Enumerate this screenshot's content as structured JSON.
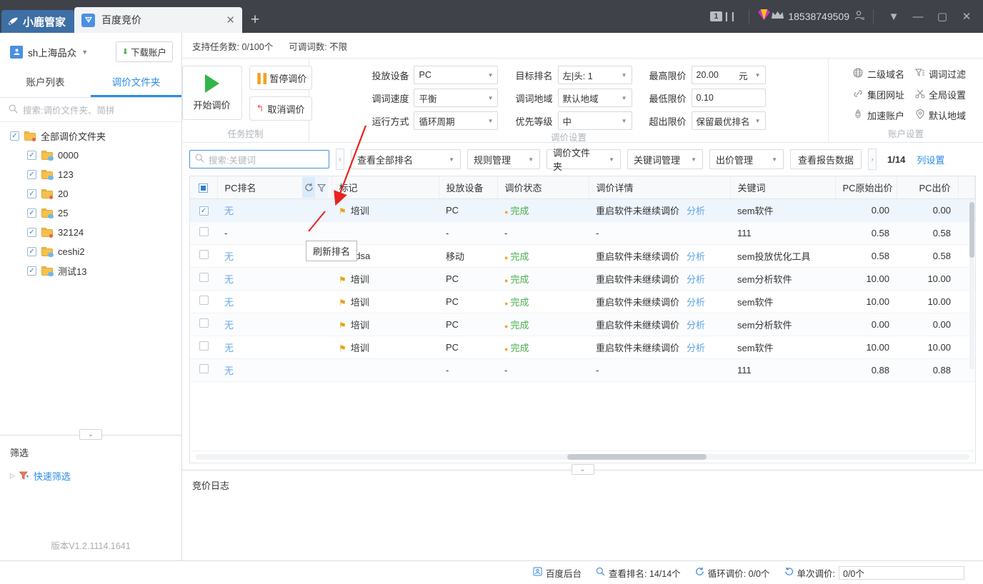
{
  "titlebar": {
    "app_name": "小鹿管家",
    "tab_label": "百度竞价",
    "tab_close": "✕",
    "new_tab": "+",
    "message_count": "1",
    "phone": "18538749509",
    "minimize": "—",
    "maximize": "▢",
    "close": "✕",
    "dropdown": "▼"
  },
  "sidebar": {
    "account_name": "sh上海品众",
    "download_button": "下载账户",
    "tabs": [
      {
        "label": "账户列表",
        "selected": false
      },
      {
        "label": "调价文件夹",
        "selected": true
      }
    ],
    "search_placeholder": "搜索:调价文件夹、简拼",
    "tree_root": {
      "label": "全部调价文件夹",
      "checked": true,
      "badge": "dot"
    },
    "tree_items": [
      {
        "label": "0000",
        "checked": true,
        "badge": "cloud"
      },
      {
        "label": "123",
        "checked": true,
        "badge": "cloud"
      },
      {
        "label": "20",
        "checked": true,
        "badge": "dot"
      },
      {
        "label": "25",
        "checked": true,
        "badge": "cloud"
      },
      {
        "label": "32124",
        "checked": true,
        "badge": "dot"
      },
      {
        "label": "ceshi2",
        "checked": true,
        "badge": "cloud"
      },
      {
        "label": "测试13",
        "checked": true,
        "badge": "cloud"
      }
    ],
    "filter_title": "筛选",
    "quick_filter": "快速筛选",
    "version": "版本V1.2.1114.1641"
  },
  "main": {
    "quota": {
      "tasks": "支持任务数: 0/100个",
      "words": "可调词数: 不限"
    },
    "task_panel": {
      "label": "任务控制",
      "start": "开始调价",
      "pause": "暂停调价",
      "cancel": "取消调价"
    },
    "tune_panel": {
      "label": "调价设置",
      "fields": [
        {
          "label": "投放设备",
          "value": "PC"
        },
        {
          "label": "调词速度",
          "value": "平衡"
        },
        {
          "label": "运行方式",
          "value": "循环周期"
        },
        {
          "label": "目标排名",
          "value": "左|头: 1"
        },
        {
          "label": "调词地域",
          "value": "默认地域"
        },
        {
          "label": "优先等级",
          "value": "中"
        },
        {
          "label": "最高限价",
          "value": "20.00",
          "unit": "元"
        },
        {
          "label": "最低限价",
          "value": "0.10"
        },
        {
          "label": "超出限价",
          "value": "保留最优排名"
        }
      ]
    },
    "account_panel": {
      "label": "账户设置",
      "items": [
        {
          "label": "二级域名",
          "icon": "globe-icon"
        },
        {
          "label": "调词过滤",
          "icon": "funnel-icon"
        },
        {
          "label": "集团网址",
          "icon": "link-icon"
        },
        {
          "label": "全局设置",
          "icon": "scissors-icon"
        },
        {
          "label": "加速账户",
          "icon": "rocket-icon"
        },
        {
          "label": "默认地域",
          "icon": "pin-icon"
        }
      ]
    },
    "toolbar": {
      "search_placeholder": "搜索:关键词",
      "collapse_left": "‹",
      "collapse_right": "›",
      "buttons": [
        "查看全部排名",
        "规则管理",
        "调价文件夹",
        "关键词管理",
        "出价管理"
      ],
      "report_button": "查看报告数据",
      "pager": "1/14",
      "column_settings": "列设置"
    },
    "tooltip": "刷新排名",
    "table": {
      "columns": [
        "PC排名",
        "标记",
        "投放设备",
        "调价状态",
        "调价详情",
        "关键词",
        "PC原始出价",
        "PC出价"
      ],
      "analyze_link": "分析",
      "rows": [
        {
          "checked": true,
          "rank": "无",
          "mark": "培训",
          "device": "PC",
          "status": "完成",
          "detail": "重启软件未继续调价",
          "keyword": "sem软件",
          "orig": "0.00",
          "bid": "0.00"
        },
        {
          "checked": false,
          "rank": "-",
          "mark": "",
          "device": "-",
          "status": "-",
          "detail": "-",
          "keyword": "111",
          "orig": "0.58",
          "bid": "0.58"
        },
        {
          "checked": false,
          "rank": "无",
          "mark": "sdsa",
          "device": "移动",
          "status": "完成",
          "detail": "重启软件未继续调价",
          "keyword": "sem投放优化工具",
          "orig": "0.58",
          "bid": "0.58"
        },
        {
          "checked": false,
          "rank": "无",
          "mark": "培训",
          "device": "PC",
          "status": "完成",
          "detail": "重启软件未继续调价",
          "keyword": "sem分析软件",
          "orig": "10.00",
          "bid": "10.00"
        },
        {
          "checked": false,
          "rank": "无",
          "mark": "培训",
          "device": "PC",
          "status": "完成",
          "detail": "重启软件未继续调价",
          "keyword": "sem软件",
          "orig": "10.00",
          "bid": "10.00"
        },
        {
          "checked": false,
          "rank": "无",
          "mark": "培训",
          "device": "PC",
          "status": "完成",
          "detail": "重启软件未继续调价",
          "keyword": "sem分析软件",
          "orig": "0.00",
          "bid": "0.00"
        },
        {
          "checked": false,
          "rank": "无",
          "mark": "培训",
          "device": "PC",
          "status": "完成",
          "detail": "重启软件未继续调价",
          "keyword": "sem软件",
          "orig": "10.00",
          "bid": "10.00"
        },
        {
          "checked": false,
          "rank": "无",
          "mark": "",
          "device": "-",
          "status": "-",
          "detail": "-",
          "keyword": "111",
          "orig": "0.88",
          "bid": "0.88"
        }
      ]
    },
    "log_title": "竞价日志"
  },
  "statusbar": {
    "baidu_backend": "百度后台",
    "view_rank": "查看排名: 14/14个",
    "loop_tune": "循环调价: 0/0个",
    "single_tune_label": "单次调价:",
    "single_tune_value": "0/0个"
  },
  "colors": {
    "accent": "#2b8ce6",
    "titlebar": "#3f4248",
    "logo": "#3d6fa5",
    "success": "#4caf50",
    "warning": "#f0a82a",
    "danger": "#e8604c"
  }
}
